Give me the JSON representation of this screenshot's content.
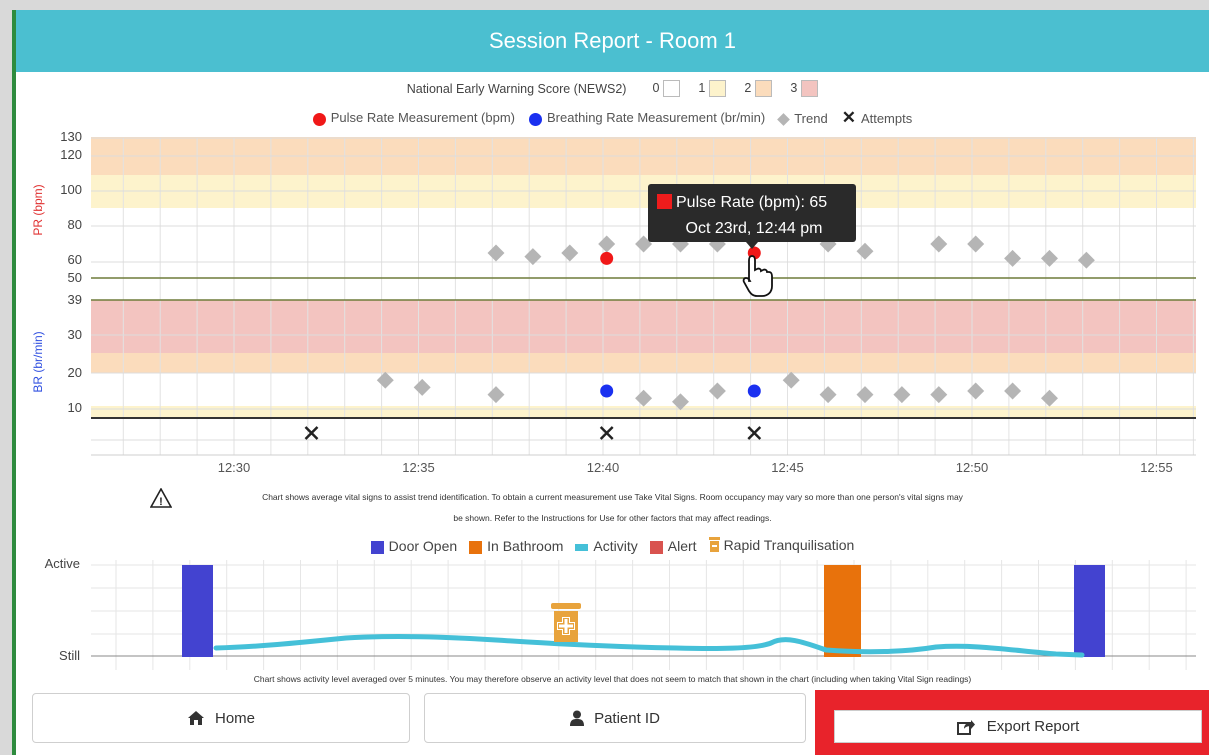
{
  "window": {
    "title": "Session Report - Room 1"
  },
  "news_legend": {
    "label": "National Early Warning Score (NEWS2)",
    "scores": [
      {
        "label": "0",
        "color": "#ffffff"
      },
      {
        "label": "1",
        "color": "#fdf3cc"
      },
      {
        "label": "2",
        "color": "#fbdcbc"
      },
      {
        "label": "3",
        "color": "#f3c4c0"
      }
    ]
  },
  "vitals_legend": {
    "pulse": "Pulse Rate Measurement (bpm)",
    "breathing": "Breathing Rate Measurement (br/min)",
    "trend": "Trend",
    "attempts": "Attempts"
  },
  "pr_axis": {
    "label": "PR (bpm)",
    "ticks": [
      "130",
      "120",
      "100",
      "80",
      "60",
      "50"
    ]
  },
  "br_axis": {
    "label": "BR (br/min)",
    "ticks": [
      "39",
      "30",
      "20",
      "10"
    ]
  },
  "time_axis": {
    "ticks": [
      "12:30",
      "12:35",
      "12:40",
      "12:45",
      "12:50",
      "12:55"
    ]
  },
  "tooltip": {
    "line1": "Pulse Rate (bpm): 65",
    "line2": "Oct 23rd, 12:44 pm"
  },
  "chart_data": {
    "type": "scatter",
    "x_unit": "time (12:mm)",
    "pulse_rate": {
      "measurements": [
        {
          "t": "12:40.1",
          "v": 62
        },
        {
          "t": "12:44.1",
          "v": 65
        }
      ],
      "trend": [
        {
          "t": "12:37.1",
          "v": 65
        },
        {
          "t": "12:38.1",
          "v": 63
        },
        {
          "t": "12:39.1",
          "v": 65
        },
        {
          "t": "12:40.1",
          "v": 70
        },
        {
          "t": "12:41.1",
          "v": 70
        },
        {
          "t": "12:42.1",
          "v": 70
        },
        {
          "t": "12:43.1",
          "v": 70
        },
        {
          "t": "12:46.1",
          "v": 70
        },
        {
          "t": "12:47.1",
          "v": 66
        },
        {
          "t": "12:49.1",
          "v": 70
        },
        {
          "t": "12:50.1",
          "v": 70
        },
        {
          "t": "12:51.1",
          "v": 62
        },
        {
          "t": "12:52.1",
          "v": 62
        },
        {
          "t": "12:53.1",
          "v": 61
        }
      ]
    },
    "breathing_rate": {
      "measurements": [
        {
          "t": "12:40.1",
          "v": 15
        },
        {
          "t": "12:44.1",
          "v": 15
        }
      ],
      "trend": [
        {
          "t": "12:34.1",
          "v": 18
        },
        {
          "t": "12:35.1",
          "v": 16
        },
        {
          "t": "12:37.1",
          "v": 14
        },
        {
          "t": "12:41.1",
          "v": 13
        },
        {
          "t": "12:42.1",
          "v": 12
        },
        {
          "t": "12:43.1",
          "v": 15
        },
        {
          "t": "12:45.1",
          "v": 18
        },
        {
          "t": "12:46.1",
          "v": 14
        },
        {
          "t": "12:47.1",
          "v": 14
        },
        {
          "t": "12:48.1",
          "v": 14
        },
        {
          "t": "12:49.1",
          "v": 14
        },
        {
          "t": "12:50.1",
          "v": 15
        },
        {
          "t": "12:51.1",
          "v": 15
        },
        {
          "t": "12:52.1",
          "v": 13
        }
      ]
    },
    "attempts": [
      "12:32.1",
      "12:40.1",
      "12:44.1"
    ]
  },
  "vitals_note": {
    "line1": "Chart shows average vital signs to assist trend identification. To obtain a current measurement use Take Vital Signs. Room occupancy may vary so more than one person's vital signs may",
    "line2": "be shown. Refer to the Instructions for Use for other factors that may affect readings."
  },
  "activity_legend": {
    "door_open": "Door Open",
    "in_bathroom": "In Bathroom",
    "activity": "Activity",
    "alert": "Alert",
    "rapid": "Rapid Tranquilisation",
    "colors": {
      "door": "#4343d0",
      "bathroom": "#e8720c",
      "activity": "#45c0d8",
      "alert": "#d9534f",
      "rapid": "#e8a33c"
    }
  },
  "activity_axis": {
    "active": "Active",
    "still": "Still"
  },
  "activity_note": "Chart shows activity level averaged over 5 minutes. You may therefore observe an activity level that does not seem to match that shown in the chart (including when taking Vital Sign readings)",
  "buttons": {
    "home": "Home",
    "patient_id": "Patient ID",
    "export": "Export Report"
  }
}
